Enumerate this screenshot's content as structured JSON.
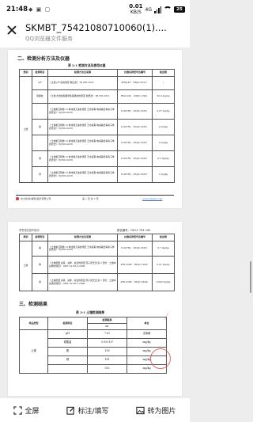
{
  "status_bar": {
    "time": "21:48",
    "mini_icons": "◆ ▣ ▢",
    "speed_value": "0.01",
    "speed_unit": "KB/S",
    "network": "4G",
    "battery": "25"
  },
  "header": {
    "title": "SKMBT_75421080710060(1)....",
    "subtitle": "QQ浏览器文件服务"
  },
  "page1": {
    "section_title": "二、检测分析方法及仪器",
    "table_caption": "表 2-1 检测方法及使用仪器",
    "columns": [
      "类别",
      "检测项目",
      "检测方法及来源",
      "仪器名称型号及编号",
      "检出限"
    ],
    "category": "土壤",
    "rows": [
      {
        "item": "pH",
        "method": "《土壤 pH 值的测定 电位法》 HJ 962-2018",
        "instrument": "PHSJ-4F （ZDJC-2221）",
        "limit": "/"
      },
      {
        "item": "硫酸盐",
        "method": "《土壤 水溶性和酸溶性硫酸盐的测定 重量法》 HJ 635-2012",
        "instrument": "BSA1245 （ZDJC-1292）",
        "limit": "50.0 mg/kg"
      },
      {
        "item": "",
        "method": "《土壤和沉积物 12 种金属元素的测定 王水提取-电感耦合等离子体质谱法》 HJ 803-2016",
        "instrument": "ICAP RQ （ZDJC-1833）",
        "limit": "0.07 mg/kg"
      },
      {
        "item": "铬",
        "method": "《土壤和沉积物 12 种金属元素的测定 王水提取-电感耦合等离子体质谱法》 HJ 803-2016",
        "instrument": "ICAP RQ （ZDJC-1833）",
        "limit": "2 mg/kg"
      },
      {
        "item": "",
        "method": "《土壤和沉积物 12 种金属元素的测定 王水提取-电感耦合等离子体质谱法》 HJ 803-2016",
        "instrument": "ICAP RQ （ZDJC-1833）",
        "limit": "2 mg/kg"
      },
      {
        "item": "铜",
        "method": "《土壤和沉积物 12 种金属元素的测定 王水提取-电感耦合等离子体质谱法》 HJ 803-2016",
        "instrument": "ICAP RQ （ZDJC-1833）",
        "limit": "0.5 mg/kg"
      },
      {
        "item": "锌",
        "method": "《土壤和沉积物 12 种金属元素的测定 王水提取-电感耦合等离子体质谱法》 HJ 803-2016",
        "instrument": "ICAP RQ （ZDJC-1833）",
        "limit": "1 mg/kg"
      }
    ],
    "footer_left": "中大检测(湖南)股份有限公司",
    "footer_mid": "第 1 页 共 2 页",
    "footer_right": "www.zdjcdx.com"
  },
  "page2": {
    "top_left": "李思规总是环检测",
    "top_right": "报告编号：GD21-7R1-286",
    "columns": [
      "类别",
      "检测项目",
      "检测方法及来源",
      "仪器名称型号及编号",
      "检出限"
    ],
    "category": "土壤",
    "rows": [
      {
        "item": "镍",
        "method": "《土壤和沉积物 12 种金属元素的测定 王水提取-电感耦合等离子体质谱法》 HJ 803-2016",
        "instrument": "ICAP RQ （ZDJC-1833）",
        "limit": "0.7 mg/kg"
      },
      {
        "item": "砷",
        "method": "《土壤质量 总汞、总砷、总铅的测定 原子荧光法 第 2 部分：土壤中总砷的测定》 GB/T 22105.2-2008",
        "instrument": "AFS-230E （ZDJC-1296）",
        "limit": "0.01 mg/kg"
      },
      {
        "item": "汞",
        "method": "《土壤质量 总汞、总砷、总铅的测定 原子荧光法 第 1 部分：土壤中总汞的测定》 GB/T 22105.1-2008",
        "instrument": "AFS-230E （ZDJC-1844）",
        "limit": "0.002 mg/kg"
      }
    ],
    "results_title": "三、检测结果",
    "results_caption": "表 3-1 土壤检测结果",
    "results_columns": [
      "样品类型",
      "检测项目",
      "检测结果",
      "单位"
    ],
    "results_subheader": "S1",
    "results_category": "土壤",
    "results_rows": [
      {
        "item": "pH",
        "value": "7.62",
        "unit": "无量纲"
      },
      {
        "item": "硫酸盐",
        "value": "5.93×10³",
        "unit": "mg/kg"
      },
      {
        "item": "铬",
        "value": "138",
        "unit": "mg/kg"
      },
      {
        "item": "铜",
        "value": "181",
        "unit": "mg/kg"
      },
      {
        "item": "",
        "value": "592",
        "unit": "mg/kg"
      }
    ]
  },
  "bottom_bar": {
    "fullscreen": "全屏",
    "annotate": "标注/填写",
    "to_image": "转为图片"
  }
}
